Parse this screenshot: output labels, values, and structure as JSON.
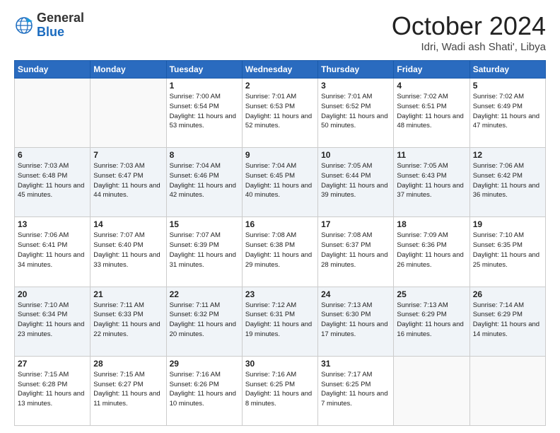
{
  "logo": {
    "general": "General",
    "blue": "Blue"
  },
  "header": {
    "month": "October 2024",
    "location": "Idri, Wadi ash Shati', Libya"
  },
  "weekdays": [
    "Sunday",
    "Monday",
    "Tuesday",
    "Wednesday",
    "Thursday",
    "Friday",
    "Saturday"
  ],
  "weeks": [
    [
      {
        "day": "",
        "sunrise": "",
        "sunset": "",
        "daylight": ""
      },
      {
        "day": "",
        "sunrise": "",
        "sunset": "",
        "daylight": ""
      },
      {
        "day": "1",
        "sunrise": "Sunrise: 7:00 AM",
        "sunset": "Sunset: 6:54 PM",
        "daylight": "Daylight: 11 hours and 53 minutes."
      },
      {
        "day": "2",
        "sunrise": "Sunrise: 7:01 AM",
        "sunset": "Sunset: 6:53 PM",
        "daylight": "Daylight: 11 hours and 52 minutes."
      },
      {
        "day": "3",
        "sunrise": "Sunrise: 7:01 AM",
        "sunset": "Sunset: 6:52 PM",
        "daylight": "Daylight: 11 hours and 50 minutes."
      },
      {
        "day": "4",
        "sunrise": "Sunrise: 7:02 AM",
        "sunset": "Sunset: 6:51 PM",
        "daylight": "Daylight: 11 hours and 48 minutes."
      },
      {
        "day": "5",
        "sunrise": "Sunrise: 7:02 AM",
        "sunset": "Sunset: 6:49 PM",
        "daylight": "Daylight: 11 hours and 47 minutes."
      }
    ],
    [
      {
        "day": "6",
        "sunrise": "Sunrise: 7:03 AM",
        "sunset": "Sunset: 6:48 PM",
        "daylight": "Daylight: 11 hours and 45 minutes."
      },
      {
        "day": "7",
        "sunrise": "Sunrise: 7:03 AM",
        "sunset": "Sunset: 6:47 PM",
        "daylight": "Daylight: 11 hours and 44 minutes."
      },
      {
        "day": "8",
        "sunrise": "Sunrise: 7:04 AM",
        "sunset": "Sunset: 6:46 PM",
        "daylight": "Daylight: 11 hours and 42 minutes."
      },
      {
        "day": "9",
        "sunrise": "Sunrise: 7:04 AM",
        "sunset": "Sunset: 6:45 PM",
        "daylight": "Daylight: 11 hours and 40 minutes."
      },
      {
        "day": "10",
        "sunrise": "Sunrise: 7:05 AM",
        "sunset": "Sunset: 6:44 PM",
        "daylight": "Daylight: 11 hours and 39 minutes."
      },
      {
        "day": "11",
        "sunrise": "Sunrise: 7:05 AM",
        "sunset": "Sunset: 6:43 PM",
        "daylight": "Daylight: 11 hours and 37 minutes."
      },
      {
        "day": "12",
        "sunrise": "Sunrise: 7:06 AM",
        "sunset": "Sunset: 6:42 PM",
        "daylight": "Daylight: 11 hours and 36 minutes."
      }
    ],
    [
      {
        "day": "13",
        "sunrise": "Sunrise: 7:06 AM",
        "sunset": "Sunset: 6:41 PM",
        "daylight": "Daylight: 11 hours and 34 minutes."
      },
      {
        "day": "14",
        "sunrise": "Sunrise: 7:07 AM",
        "sunset": "Sunset: 6:40 PM",
        "daylight": "Daylight: 11 hours and 33 minutes."
      },
      {
        "day": "15",
        "sunrise": "Sunrise: 7:07 AM",
        "sunset": "Sunset: 6:39 PM",
        "daylight": "Daylight: 11 hours and 31 minutes."
      },
      {
        "day": "16",
        "sunrise": "Sunrise: 7:08 AM",
        "sunset": "Sunset: 6:38 PM",
        "daylight": "Daylight: 11 hours and 29 minutes."
      },
      {
        "day": "17",
        "sunrise": "Sunrise: 7:08 AM",
        "sunset": "Sunset: 6:37 PM",
        "daylight": "Daylight: 11 hours and 28 minutes."
      },
      {
        "day": "18",
        "sunrise": "Sunrise: 7:09 AM",
        "sunset": "Sunset: 6:36 PM",
        "daylight": "Daylight: 11 hours and 26 minutes."
      },
      {
        "day": "19",
        "sunrise": "Sunrise: 7:10 AM",
        "sunset": "Sunset: 6:35 PM",
        "daylight": "Daylight: 11 hours and 25 minutes."
      }
    ],
    [
      {
        "day": "20",
        "sunrise": "Sunrise: 7:10 AM",
        "sunset": "Sunset: 6:34 PM",
        "daylight": "Daylight: 11 hours and 23 minutes."
      },
      {
        "day": "21",
        "sunrise": "Sunrise: 7:11 AM",
        "sunset": "Sunset: 6:33 PM",
        "daylight": "Daylight: 11 hours and 22 minutes."
      },
      {
        "day": "22",
        "sunrise": "Sunrise: 7:11 AM",
        "sunset": "Sunset: 6:32 PM",
        "daylight": "Daylight: 11 hours and 20 minutes."
      },
      {
        "day": "23",
        "sunrise": "Sunrise: 7:12 AM",
        "sunset": "Sunset: 6:31 PM",
        "daylight": "Daylight: 11 hours and 19 minutes."
      },
      {
        "day": "24",
        "sunrise": "Sunrise: 7:13 AM",
        "sunset": "Sunset: 6:30 PM",
        "daylight": "Daylight: 11 hours and 17 minutes."
      },
      {
        "day": "25",
        "sunrise": "Sunrise: 7:13 AM",
        "sunset": "Sunset: 6:29 PM",
        "daylight": "Daylight: 11 hours and 16 minutes."
      },
      {
        "day": "26",
        "sunrise": "Sunrise: 7:14 AM",
        "sunset": "Sunset: 6:29 PM",
        "daylight": "Daylight: 11 hours and 14 minutes."
      }
    ],
    [
      {
        "day": "27",
        "sunrise": "Sunrise: 7:15 AM",
        "sunset": "Sunset: 6:28 PM",
        "daylight": "Daylight: 11 hours and 13 minutes."
      },
      {
        "day": "28",
        "sunrise": "Sunrise: 7:15 AM",
        "sunset": "Sunset: 6:27 PM",
        "daylight": "Daylight: 11 hours and 11 minutes."
      },
      {
        "day": "29",
        "sunrise": "Sunrise: 7:16 AM",
        "sunset": "Sunset: 6:26 PM",
        "daylight": "Daylight: 11 hours and 10 minutes."
      },
      {
        "day": "30",
        "sunrise": "Sunrise: 7:16 AM",
        "sunset": "Sunset: 6:25 PM",
        "daylight": "Daylight: 11 hours and 8 minutes."
      },
      {
        "day": "31",
        "sunrise": "Sunrise: 7:17 AM",
        "sunset": "Sunset: 6:25 PM",
        "daylight": "Daylight: 11 hours and 7 minutes."
      },
      {
        "day": "",
        "sunrise": "",
        "sunset": "",
        "daylight": ""
      },
      {
        "day": "",
        "sunrise": "",
        "sunset": "",
        "daylight": ""
      }
    ]
  ]
}
